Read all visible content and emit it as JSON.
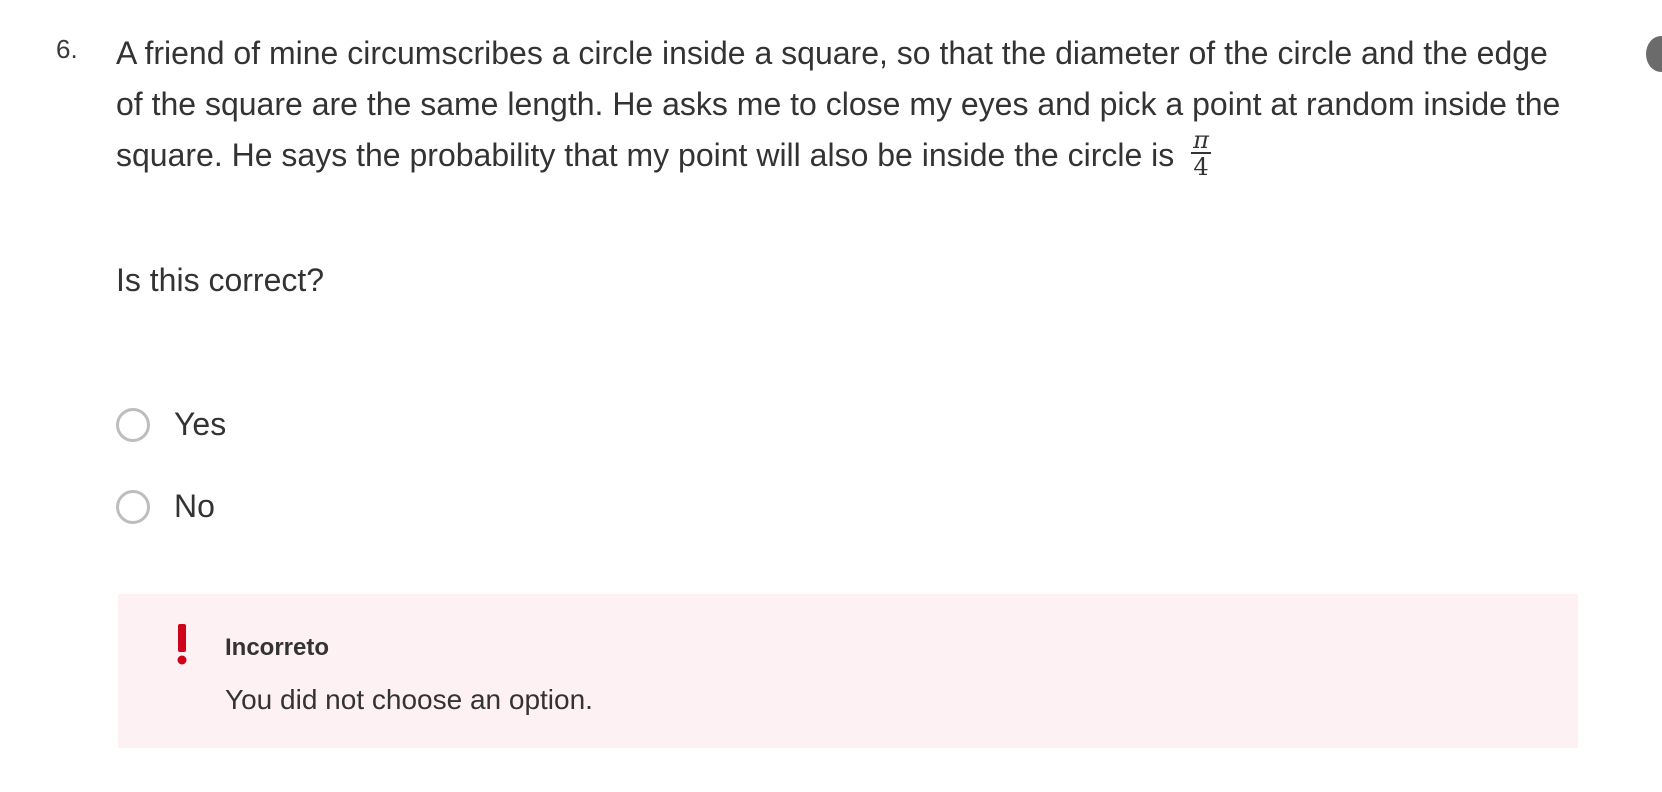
{
  "question": {
    "number": "6.",
    "text": "A friend of mine circumscribes a circle inside a square, so that the diameter of the circle and the edge of the square are the same length. He asks me to close my eyes and pick a point at random inside the square. He says the probability that my point will also be inside the circle is",
    "fraction_numerator": "π",
    "fraction_denominator": "4",
    "prompt": "Is this correct?"
  },
  "options": [
    {
      "label": "Yes",
      "selected": false
    },
    {
      "label": "No",
      "selected": false
    }
  ],
  "feedback": {
    "icon": "exclamation-icon",
    "title": "Incorreto",
    "message": "You did not choose an option.",
    "accent_color": "#d0021b",
    "background_color": "#fdf1f3"
  }
}
